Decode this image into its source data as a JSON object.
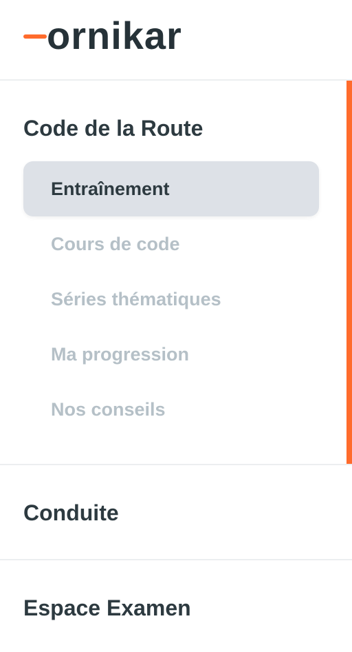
{
  "brand": {
    "name": "ornikar",
    "accent_color": "#ff6b2c",
    "text_color": "#263238"
  },
  "sections": [
    {
      "title": "Code de la Route",
      "expanded": true,
      "items": [
        {
          "label": "Entraînement",
          "active": true
        },
        {
          "label": "Cours de code",
          "active": false
        },
        {
          "label": "Séries thématiques",
          "active": false
        },
        {
          "label": "Ma progression",
          "active": false
        },
        {
          "label": "Nos conseils",
          "active": false
        }
      ]
    },
    {
      "title": "Conduite",
      "expanded": false
    },
    {
      "title": "Espace Examen",
      "expanded": false
    }
  ],
  "colors": {
    "active_item_bg": "#dde1e7",
    "inactive_item_text": "#b5c0c7",
    "divider": "#eceef0"
  }
}
